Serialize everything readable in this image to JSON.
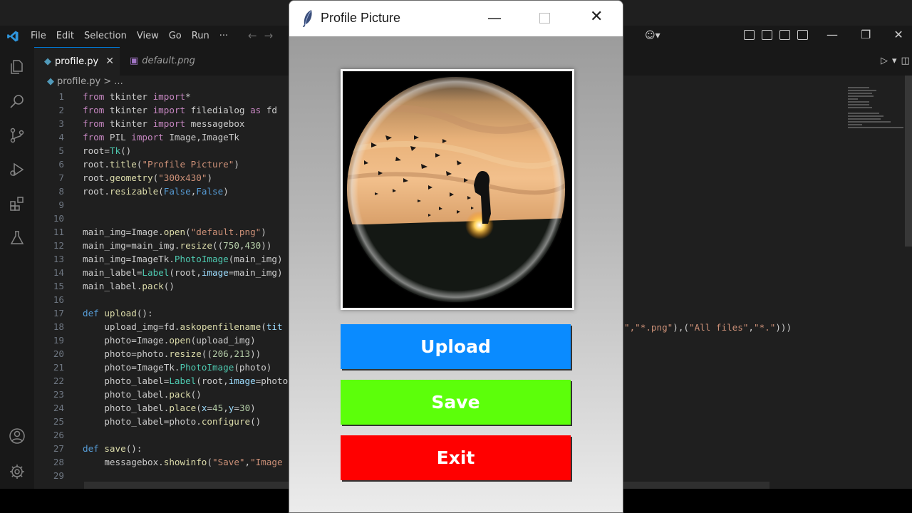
{
  "vscode": {
    "menus": [
      "File",
      "Edit",
      "Selection",
      "View",
      "Go",
      "Run",
      "···"
    ],
    "tabs": [
      {
        "label": "profile.py",
        "active": true
      },
      {
        "label": "default.png",
        "active": false
      }
    ],
    "breadcrumb": "profile.py > ...",
    "code_lines": [
      {
        "n": "1",
        "html": "<span class='kw'>from</span> tkinter <span class='kw'>import</span>*"
      },
      {
        "n": "2",
        "html": "<span class='kw'>from</span> tkinter <span class='kw'>import</span> filedialog <span class='kw'>as</span> fd"
      },
      {
        "n": "3",
        "html": "<span class='kw'>from</span> tkinter <span class='kw'>import</span> messagebox"
      },
      {
        "n": "4",
        "html": "<span class='kw'>from</span> PIL <span class='kw'>import</span> Image,ImageTk"
      },
      {
        "n": "5",
        "html": "root=<span class='cl'>Tk</span>()"
      },
      {
        "n": "6",
        "html": "root.<span class='fn'>title</span>(<span class='st'>\"Profile Picture\"</span>)"
      },
      {
        "n": "7",
        "html": "root.<span class='fn'>geometry</span>(<span class='st'>\"300x430\"</span>)"
      },
      {
        "n": "8",
        "html": "root.<span class='fn'>resizable</span>(<span class='bl'>False</span>,<span class='bl'>False</span>)"
      },
      {
        "n": "9",
        "html": ""
      },
      {
        "n": "10",
        "html": ""
      },
      {
        "n": "11",
        "html": "main_img=Image.<span class='fn'>open</span>(<span class='st'>\"default.png\"</span>)"
      },
      {
        "n": "12",
        "html": "main_img=main_img.<span class='fn'>resize</span>((<span class='nm'>750</span>,<span class='nm'>430</span>))"
      },
      {
        "n": "13",
        "html": "main_img=ImageTk.<span class='cl'>PhotoImage</span>(main_img)"
      },
      {
        "n": "14",
        "html": "main_label=<span class='cl'>Label</span>(root,<span class='vr'>image</span>=main_img)"
      },
      {
        "n": "15",
        "html": "main_label.<span class='fn'>pack</span>()"
      },
      {
        "n": "16",
        "html": ""
      },
      {
        "n": "17",
        "html": "<span class='bl'>def</span> <span class='fn'>upload</span>():"
      },
      {
        "n": "18",
        "html": "    upload_img=fd.<span class='fn'>askopenfilename</span>(<span class='vr'>tit</span>"
      },
      {
        "n": "19",
        "html": "    photo=Image.<span class='fn'>open</span>(upload_img)"
      },
      {
        "n": "20",
        "html": "    photo=photo.<span class='fn'>resize</span>((<span class='nm'>206</span>,<span class='nm'>213</span>))"
      },
      {
        "n": "21",
        "html": "    photo=ImageTk.<span class='cl'>PhotoImage</span>(photo)"
      },
      {
        "n": "22",
        "html": "    photo_label=<span class='cl'>Label</span>(root,<span class='vr'>image</span>=photo"
      },
      {
        "n": "23",
        "html": "    photo_label.<span class='fn'>pack</span>()"
      },
      {
        "n": "24",
        "html": "    photo_label.<span class='fn'>place</span>(<span class='vr'>x</span>=<span class='nm'>45</span>,<span class='vr'>y</span>=<span class='nm'>30</span>)"
      },
      {
        "n": "25",
        "html": "    photo_label=photo.<span class='fn'>configure</span>()"
      },
      {
        "n": "26",
        "html": ""
      },
      {
        "n": "27",
        "html": "<span class='bl'>def</span> <span class='fn'>save</span>():"
      },
      {
        "n": "28",
        "html": "    messagebox.<span class='fn'>showinfo</span>(<span class='st'>\"Save\"</span>,<span class='st'>\"Image</span>"
      },
      {
        "n": "29",
        "html": ""
      }
    ],
    "line18_tail": "<span class='st'>\",\"*.png\"</span>),(<span class='st'>\"All files\"</span>,<span class='st'>\"*.\"</span>)))"
  },
  "tk_window": {
    "title": "Profile Picture",
    "buttons": {
      "upload": {
        "label": "Upload",
        "color": "#0a8bff"
      },
      "save": {
        "label": "Save",
        "color": "#5cff0a"
      },
      "exit": {
        "label": "Exit",
        "color": "#ff0000"
      }
    }
  }
}
